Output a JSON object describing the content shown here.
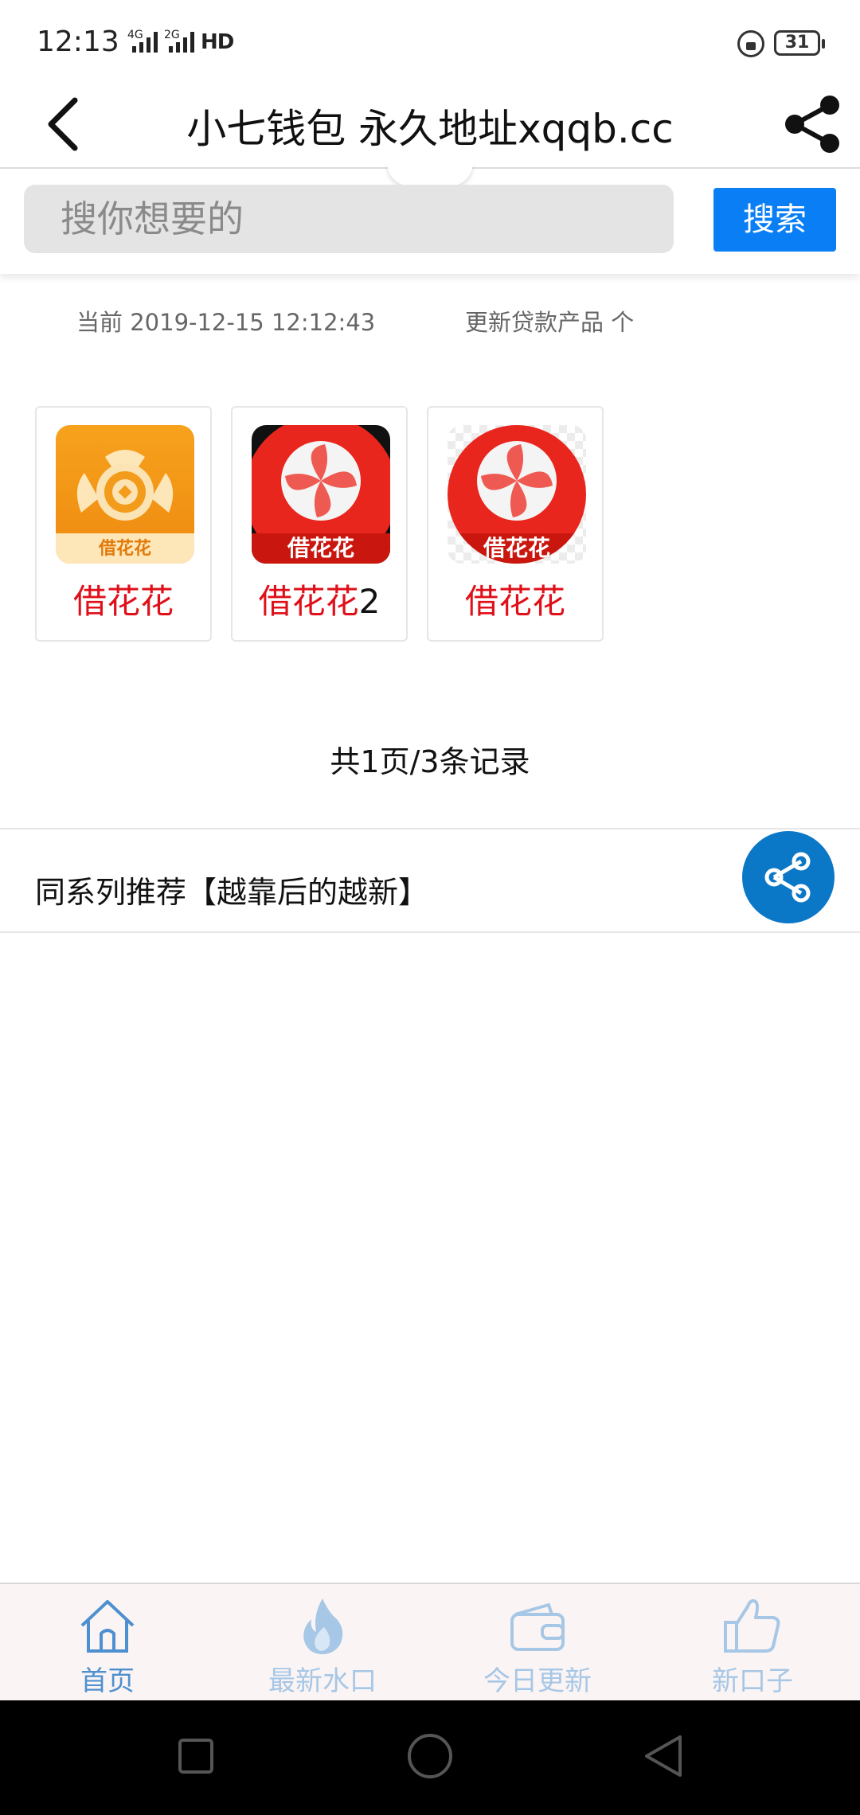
{
  "status_bar": {
    "time": "12:13",
    "signal_1": "4G",
    "signal_2": "2G",
    "hd_label": "HD",
    "battery": "31"
  },
  "header": {
    "title": "小七钱包 永久地址xqqb.cc",
    "back_icon": "chevron-left-icon",
    "share_icon": "share-icon"
  },
  "search": {
    "placeholder": "搜你想要的",
    "button_label": "搜索"
  },
  "info": {
    "current_time": "当前 2019-12-15 12:12:43",
    "update_text": "更新贷款产品 个"
  },
  "products": [
    {
      "name": "借花花",
      "suffix": "",
      "icon_text": "借花花",
      "icon": "coin-wings-icon"
    },
    {
      "name": "借花花",
      "suffix": "2",
      "icon_text": "借花花",
      "icon": "pinwheel-icon"
    },
    {
      "name": "借花花",
      "suffix": "",
      "icon_text": "借花花",
      "icon": "pinwheel-icon"
    }
  ],
  "pager": {
    "text": "共1页/3条记录"
  },
  "section": {
    "title": "同系列推荐【越靠后的越新】",
    "fab_icon": "share-icon"
  },
  "bottom_nav": [
    {
      "label": "首页",
      "icon": "home-icon",
      "active": true
    },
    {
      "label": "最新水口",
      "icon": "flame-icon",
      "active": false
    },
    {
      "label": "今日更新",
      "icon": "wallet-icon",
      "active": false
    },
    {
      "label": "新口子",
      "icon": "thumbs-up-icon",
      "active": false
    }
  ],
  "colors": {
    "accent": "#0a7ff5",
    "product_name": "#e0101a",
    "fab": "#0b77c7",
    "nav_active": "#4e90cf",
    "nav_inactive": "#a6c7e6"
  }
}
